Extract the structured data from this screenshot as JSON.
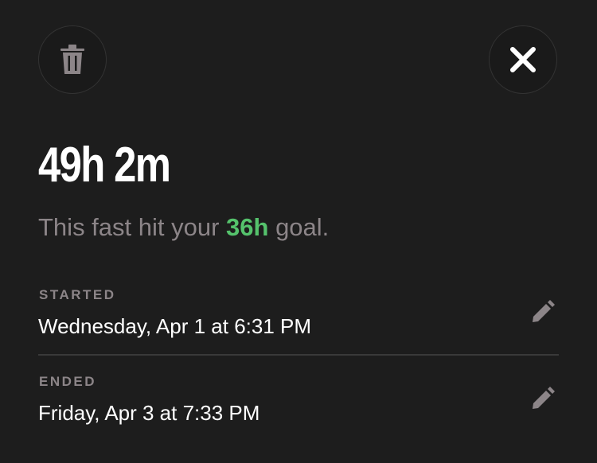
{
  "summary": {
    "duration": "49h 2m",
    "goal_prefix": "This fast hit your ",
    "goal_value": "36h",
    "goal_suffix": " goal."
  },
  "started": {
    "label": "STARTED",
    "value": "Wednesday, Apr 1 at 6:31 PM"
  },
  "ended": {
    "label": "ENDED",
    "value": "Friday, Apr 3 at 7:33 PM"
  },
  "icons": {
    "delete": "trash-icon",
    "close": "close-icon",
    "edit": "pencil-icon"
  },
  "colors": {
    "background": "#1d1d1d",
    "muted_text": "#8c8588",
    "goal_accent": "#55c26c",
    "icon_gray": "#8c8588"
  }
}
